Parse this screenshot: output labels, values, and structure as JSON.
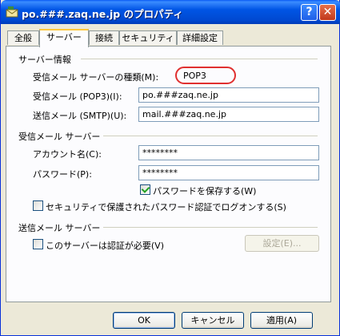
{
  "window": {
    "title": "po.###.zaq.ne.jp のプロパティ",
    "help": "?",
    "close": "✕"
  },
  "tabs": [
    "全般",
    "サーバー",
    "接続",
    "セキュリティ",
    "詳細設定"
  ],
  "server_info": {
    "heading": "サーバー情報",
    "type_label": "受信メール サーバーの種類(M):",
    "type_value": "POP3",
    "incoming_label": "受信メール (POP3)(I):",
    "incoming_value": "po.###zaq.ne.jp",
    "outgoing_label": "送信メール (SMTP)(U):",
    "outgoing_value": "mail.###zaq.ne.jp"
  },
  "incoming_server": {
    "heading": "受信メール サーバー",
    "account_label": "アカウント名(C):",
    "account_value": "********",
    "password_label": "パスワード(P):",
    "password_value": "********",
    "save_password": "パスワードを保存する(W)",
    "spa_logon": "セキュリティで保護されたパスワード認証でログオンする(S)"
  },
  "outgoing_server": {
    "heading": "送信メール サーバー",
    "auth_required": "このサーバーは認証が必要(V)",
    "settings_button": "設定(E)..."
  },
  "buttons": {
    "ok": "OK",
    "cancel": "キャンセル",
    "apply": "適用(A)"
  },
  "colors": {
    "title_bar": "#0055E5",
    "tab_highlight": "#FFC83C",
    "oval": "#E03030"
  }
}
